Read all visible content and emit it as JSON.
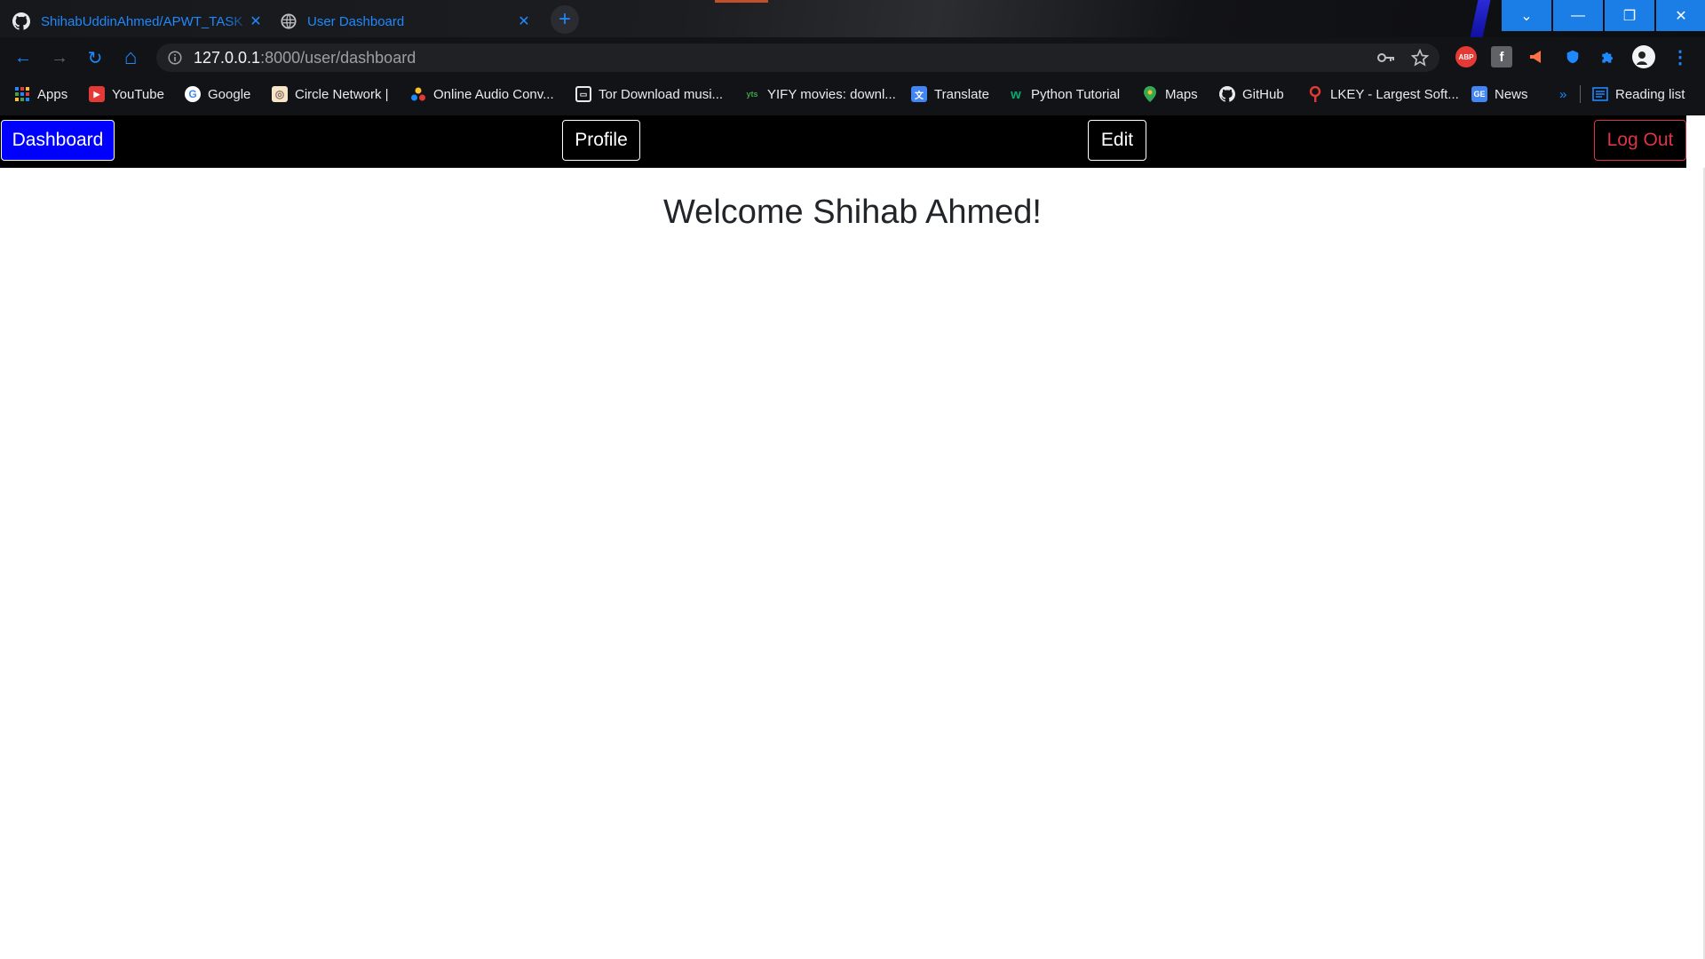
{
  "browser": {
    "tabs": [
      {
        "title": "ShihabUddinAhmed/APWT_TASK",
        "icon": "github-icon",
        "close": "✕"
      },
      {
        "title": "User Dashboard",
        "icon": "globe-icon",
        "close": "✕"
      }
    ],
    "new_tab": "+",
    "window_controls": {
      "dropdown": "⌄",
      "minimize": "—",
      "restore": "❐",
      "close": "✕"
    },
    "url_host": "127.0.0.1",
    "url_path": ":8000/user/dashboard",
    "nav_icons": {
      "back": "←",
      "forward": "→",
      "reload": "↻",
      "home": "⌂"
    },
    "bookmarks": [
      {
        "label": "Apps",
        "icon": "apps-grid-icon"
      },
      {
        "label": "YouTube",
        "icon": "youtube-icon"
      },
      {
        "label": "Google",
        "icon": "google-icon"
      },
      {
        "label": "Circle Network |",
        "icon": "circle-network-icon"
      },
      {
        "label": "Online Audio Conv...",
        "icon": "audio-converter-icon"
      },
      {
        "label": "Tor Download musi...",
        "icon": "tor-download-icon"
      },
      {
        "label": "YIFY movies: downl...",
        "icon": "yify-icon"
      },
      {
        "label": "Translate",
        "icon": "translate-icon"
      },
      {
        "label": "Python Tutorial",
        "icon": "w3schools-icon"
      },
      {
        "label": "Maps",
        "icon": "maps-pin-icon"
      },
      {
        "label": "GitHub",
        "icon": "github-icon"
      },
      {
        "label": "LKEY - Largest Soft...",
        "icon": "lkey-icon"
      },
      {
        "label": "News",
        "icon": "news-icon"
      }
    ],
    "bookmarks_overflow": "»",
    "reading_list": "Reading list",
    "extension_labels": {
      "abp": "ABP"
    }
  },
  "navbar": {
    "dashboard_label": "Dashboard",
    "profile_label": "Profile",
    "edit_label": "Edit",
    "logout_label": "Log Out"
  },
  "main": {
    "welcome": "Welcome Shihab Ahmed!"
  },
  "colors": {
    "accent_blue": "#1e88ff",
    "dashboard_bg": "#0000ff",
    "logout_red": "#dc3545",
    "navbar_bg": "#000000"
  }
}
